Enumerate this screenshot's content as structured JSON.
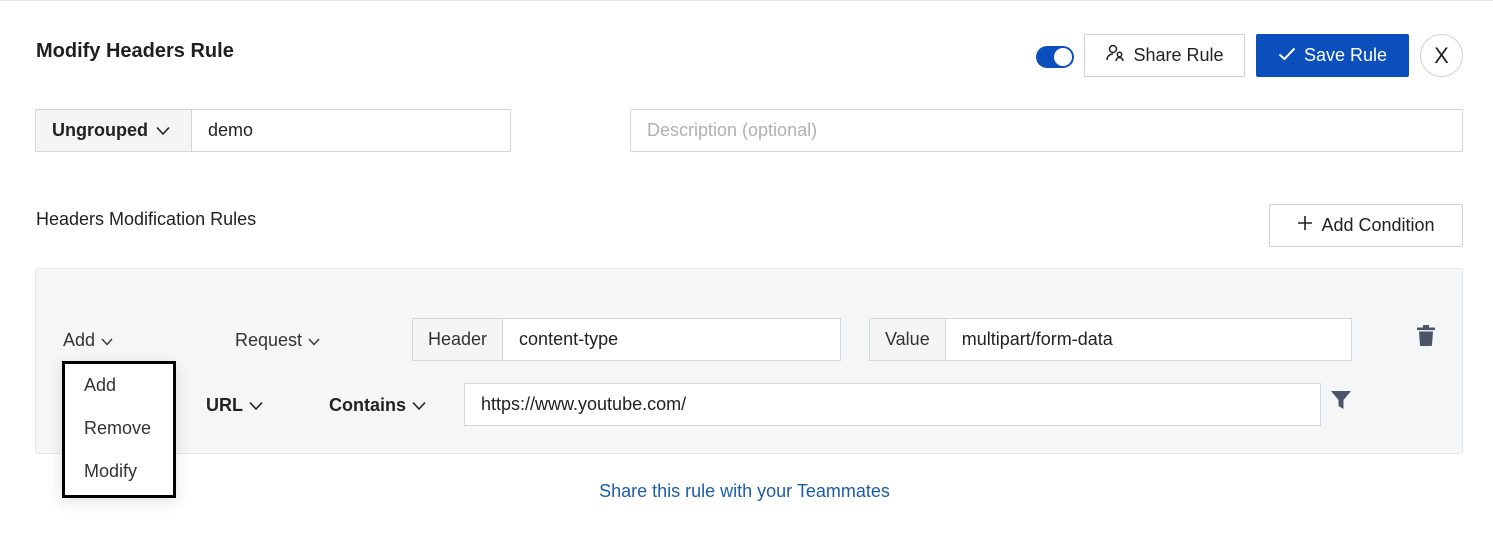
{
  "header": {
    "title": "Modify Headers Rule",
    "toggle_on": true,
    "share_label": "Share Rule",
    "save_label": "Save Rule",
    "close_label": "X"
  },
  "rule_meta": {
    "group_label": "Ungrouped",
    "name_value": "demo",
    "description_placeholder": "Description (optional)",
    "description_value": ""
  },
  "section": {
    "title": "Headers Modification Rules",
    "add_condition_label": "Add Condition"
  },
  "modification": {
    "action_label": "Add",
    "target_label": "Request",
    "header_addon": "Header",
    "header_value": "content-type",
    "value_addon": "Value",
    "value_value": "multipart/form-data"
  },
  "source": {
    "key_label": "URL",
    "operator_label": "Contains",
    "value": "https://www.youtube.com/"
  },
  "action_menu": {
    "items": [
      "Add",
      "Remove",
      "Modify"
    ]
  },
  "footer": {
    "share_link": "Share this rule with your Teammates"
  },
  "colors": {
    "primary": "#0b4fbc",
    "link": "#1c5bab",
    "panel_bg": "#f5f6f8"
  }
}
